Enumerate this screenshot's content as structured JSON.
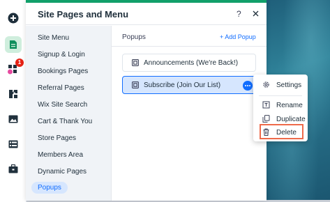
{
  "left_rail": {
    "icons": [
      "add-icon",
      "pages-icon",
      "design-icon",
      "apps-icon",
      "media-icon",
      "table-icon",
      "business-icon"
    ],
    "badge_count": "1"
  },
  "panel": {
    "title": "Site Pages and Menu",
    "help_label": "?",
    "sidebar_items": [
      {
        "label": "Site Menu"
      },
      {
        "label": "Signup & Login"
      },
      {
        "label": "Bookings Pages"
      },
      {
        "label": "Referral Pages"
      },
      {
        "label": "Wix Site Search"
      },
      {
        "label": "Cart & Thank You"
      },
      {
        "label": "Store Pages"
      },
      {
        "label": "Members Area"
      },
      {
        "label": "Dynamic Pages"
      },
      {
        "label": "Popups"
      }
    ],
    "active_item": "Popups",
    "content": {
      "title": "Popups",
      "add_label": "+ Add Popup",
      "popups": [
        {
          "label": "Announcements (We're Back!)"
        },
        {
          "label": "Subscribe (Join Our List)"
        }
      ]
    }
  },
  "context_menu": {
    "items": [
      {
        "label": "Settings",
        "icon": "gear-icon"
      },
      {
        "label": "Rename",
        "icon": "rename-icon"
      },
      {
        "label": "Duplicate",
        "icon": "duplicate-icon"
      },
      {
        "label": "Delete",
        "icon": "trash-icon"
      }
    ]
  },
  "colors": {
    "accent": "#116dff",
    "brand_green": "#11a06a",
    "highlight": "#ee6a4a",
    "badge": "#e62214"
  }
}
